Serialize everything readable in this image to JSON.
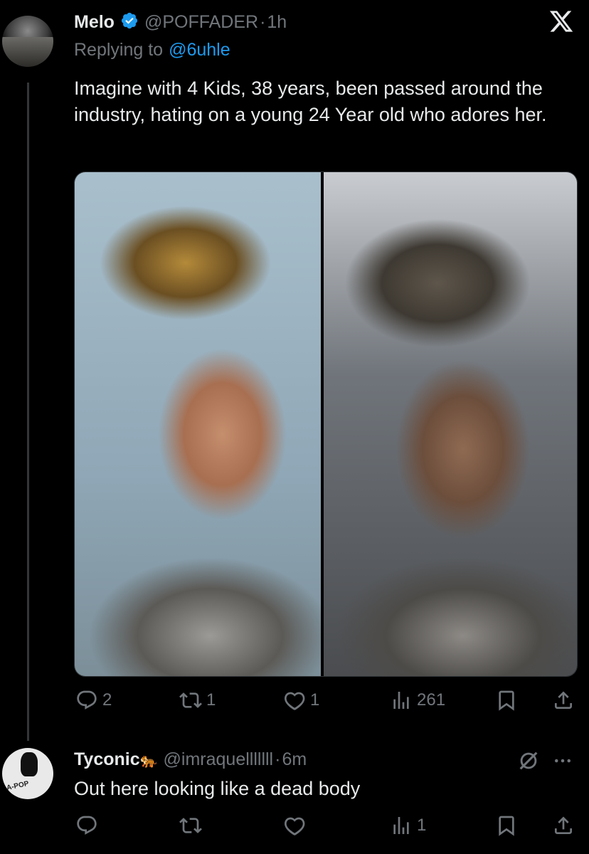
{
  "tweet": {
    "author_name": "Melo",
    "handle": "@POFFADER",
    "separator": "·",
    "time": "1h",
    "replying_prefix": "Replying to",
    "replying_to": "@6uhle",
    "text": "Imagine with 4 Kids, 38 years, been passed around the industry, hating on a young 24 Year old who adores her.",
    "replies": "2",
    "reposts": "1",
    "likes": "1",
    "views": "261"
  },
  "reply": {
    "author_name": "Tyconic",
    "emoji": "🐅",
    "handle": "@imraquelllllll",
    "separator": "·",
    "time": "6m",
    "text": "Out here looking like a dead body",
    "views": "1",
    "avatar_label": "A-POP"
  },
  "icons": {
    "x_logo": "x-logo-icon",
    "verified": "verified-badge-icon",
    "more": "more-icon",
    "grok": "grok-icon"
  },
  "colors": {
    "background": "#000000",
    "text": "#e7e9ea",
    "muted": "#71767b",
    "accent": "#1d9bf0"
  }
}
